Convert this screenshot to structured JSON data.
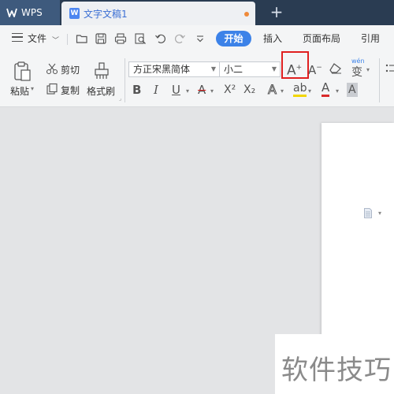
{
  "titlebar": {
    "app_tab": "WPS",
    "doc_tab": "文字文稿1",
    "new_tab_symbol": "+"
  },
  "menubar": {
    "file_label": "文件",
    "tabs": [
      "开始",
      "插入",
      "页面布局",
      "引用"
    ]
  },
  "ribbon": {
    "paste_label": "粘贴",
    "cut_label": "剪切",
    "copy_label": "复制",
    "format_painter_label": "格式刷",
    "font_name": "方正宋黑简体",
    "font_size": "小二",
    "bold": "B",
    "italic": "I",
    "underline": "U",
    "strikethrough": "A",
    "superscript": "X²",
    "subscript": "X₂",
    "text_effect": "A",
    "highlight": "ab",
    "font_color": "A",
    "char_shading": "A",
    "phonetic_label": "wén",
    "phonetic_char": "变",
    "grow_font": "A",
    "shrink_font": "A"
  },
  "watermark": {
    "text": "软件技巧"
  },
  "colors": {
    "titlebar_bg": "#2a3c52",
    "accent": "#3c82e8",
    "highlight_border": "#e02020"
  }
}
